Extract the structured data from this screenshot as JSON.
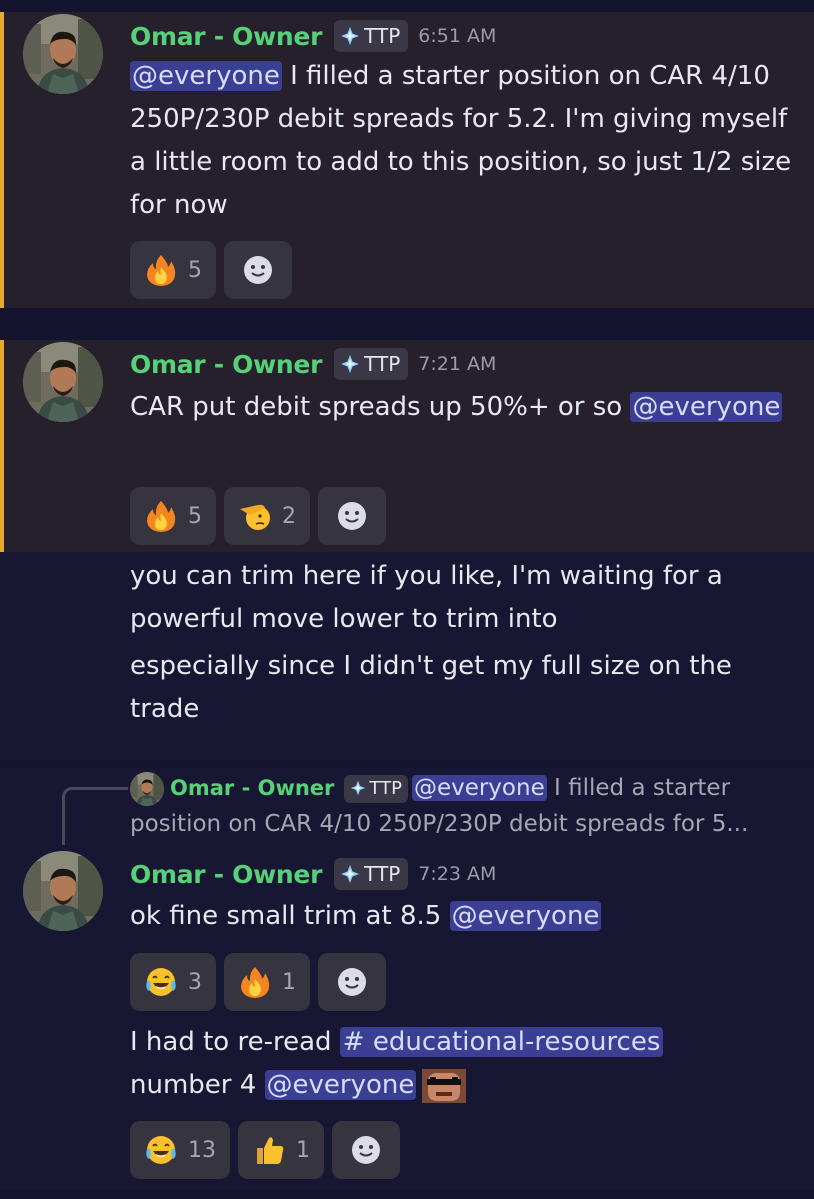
{
  "messages": [
    {
      "author": "Omar - Owner",
      "tag": "TTP",
      "time": "6:51 AM",
      "mention": "@everyone",
      "text_after_mention": " I filled a starter position on CAR 4/10 250P/230P debit spreads for 5.2. I'm giving myself a little room to add to this position, so just 1/2 size for now",
      "reactions": [
        {
          "emoji": "fire-emoji",
          "count": "5"
        }
      ]
    },
    {
      "author": "Omar - Owner",
      "tag": "TTP",
      "time": "7:21 AM",
      "text_before_mention": "CAR put debit spreads up 50%+ or so ",
      "mention": "@everyone",
      "reactions": [
        {
          "emoji": "fire-emoji",
          "count": "5"
        },
        {
          "emoji": "salute-emoji",
          "count": "2"
        }
      ],
      "followups": [
        "you can trim here if you like, I'm waiting for a powerful move lower to trim into",
        "especially since I didn't get my full size on the trade"
      ]
    },
    {
      "reply_to": {
        "author": "Omar - Owner",
        "tag": "TTP",
        "mention": "@everyone",
        "preview": " I filled a starter position on CAR 4/10 250P/230P debit spreads for 5..."
      },
      "author": "Omar - Owner",
      "tag": "TTP",
      "time": "7:23 AM",
      "text_before_mention": "ok fine small trim at 8.5 ",
      "mention": "@everyone",
      "reactions": [
        {
          "emoji": "joy-emoji",
          "count": "3"
        },
        {
          "emoji": "fire-emoji",
          "count": "1"
        }
      ],
      "followup": {
        "text_before_channel": "I had to re-read ",
        "channel": "# educational-resources",
        "text_after_channel": " number 4 ",
        "mention": "@everyone",
        "emote": "deal-with-it-emote"
      },
      "followup_reactions": [
        {
          "emoji": "joy-emoji",
          "count": "13"
        },
        {
          "emoji": "thumbs-up-emoji",
          "count": "1"
        }
      ]
    }
  ],
  "colors": {
    "author": "#57d178",
    "mention_bg": "#3b3f94",
    "highlight_bar": "#e3a92d",
    "highlight_bg": "#26202c",
    "background": "#171734"
  }
}
